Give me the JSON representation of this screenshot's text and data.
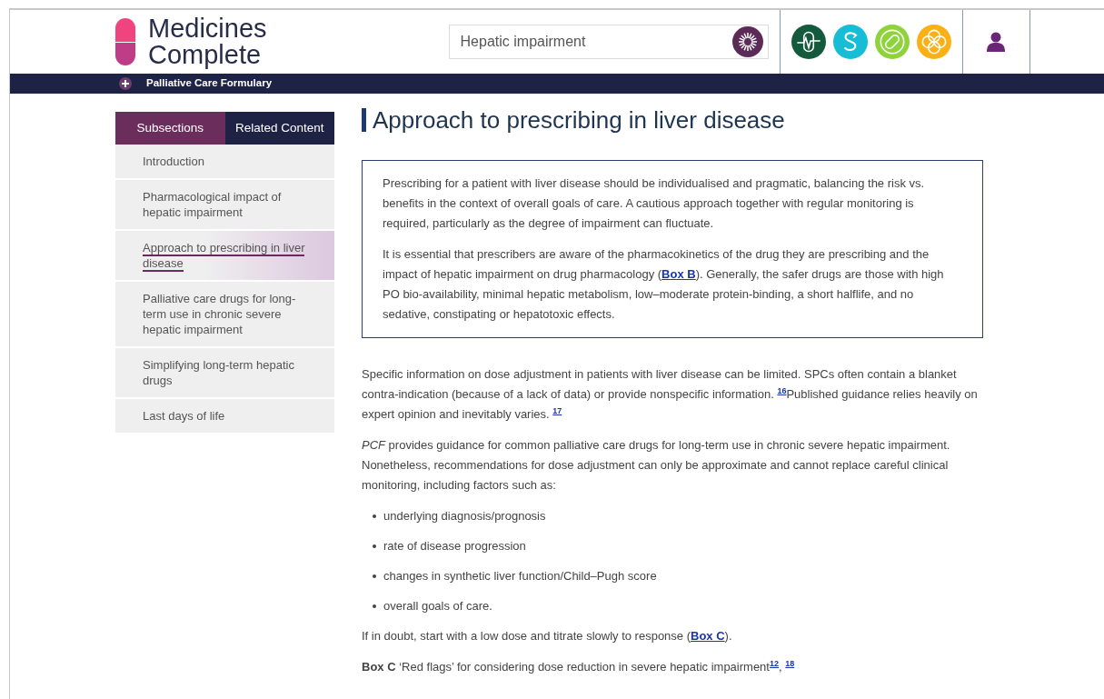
{
  "header": {
    "logo_lines": [
      "Medicines",
      "Complete"
    ],
    "search": {
      "value": "Hepatic impairment"
    }
  },
  "banner": {
    "title": "Palliative Care Formulary"
  },
  "sidebar": {
    "tabs": [
      {
        "label": "Subsections",
        "selected": true
      },
      {
        "label": "Related Content",
        "selected": false
      }
    ],
    "items": [
      {
        "label": "Introduction",
        "selected": false
      },
      {
        "label": "Pharmacological impact of hepatic impairment",
        "selected": false
      },
      {
        "label": "Approach to prescribing in liver disease",
        "selected": true
      },
      {
        "label": "Palliative care drugs for long-term use in chronic severe hepatic impairment",
        "selected": false
      },
      {
        "label": "Simplifying long-term hepatic drugs",
        "selected": false
      },
      {
        "label": "Last days of life",
        "selected": false
      }
    ]
  },
  "article": {
    "title": "Approach to prescribing in liver disease",
    "summary_box": [
      [
        {
          "kind": "text",
          "text": "Prescribing for a patient with liver disease should be individualised and pragmatic, balancing the risk vs. benefits in the context of overall goals of care. A cautious approach together with regular monitoring is required, particularly as the degree of impairment can fluctuate."
        }
      ],
      [
        {
          "kind": "text",
          "text": "It is essential that prescribers are aware of the pharmacokinetics of the drug they are prescribing and the impact of hepatic impairment on drug pharmacology ("
        },
        {
          "kind": "link",
          "text": "Box B"
        },
        {
          "kind": "text",
          "text": "). Generally, the safer drugs are those with high PO bio-availability, minimal hepatic metabolism, low–moderate protein-binding, a short halflife, and no sedative, constipating or hepatotoxic effects."
        }
      ]
    ],
    "blocks": [
      {
        "kind": "paragraph",
        "parts": [
          {
            "kind": "text",
            "text": "Specific information on dose adjustment in patients with liver disease can be limited. SPCs often contain a blanket contra-indication (because of a lack of data) or provide nonspecific information. "
          },
          {
            "kind": "ref",
            "text": "16"
          },
          {
            "kind": "text",
            "text": "Published guidance relies heavily on expert opinion and inevitably varies. "
          },
          {
            "kind": "ref",
            "text": "17"
          }
        ]
      },
      {
        "kind": "paragraph",
        "parts": [
          {
            "kind": "text",
            "text": "*PCF* provides guidance for common palliative care drugs for long-term use in chronic severe hepatic impairment. Nonetheless, recommendations for dose adjustment can only be approximate and cannot replace careful clinical monitoring, including factors such as:"
          }
        ]
      },
      {
        "kind": "bullets",
        "items": [
          "underlying diagnosis/prognosis",
          "rate of disease progression",
          "changes in synthetic liver function/Child–Pugh score",
          "overall goals of care."
        ]
      },
      {
        "kind": "paragraph",
        "parts": [
          {
            "kind": "text",
            "text": "If in doubt, start with a low dose and titrate slowly to response ("
          },
          {
            "kind": "link",
            "text": "Box C"
          },
          {
            "kind": "text",
            "text": ")."
          }
        ]
      },
      {
        "kind": "paragraph",
        "parts": [
          {
            "kind": "text",
            "text": "**Box C** ‘Red flags’ for considering dose reduction in severe hepatic impairment"
          },
          {
            "kind": "ref",
            "text": "12"
          },
          {
            "kind": "text",
            "text": ", "
          },
          {
            "kind": "ref",
            "text": "18"
          }
        ]
      }
    ]
  }
}
